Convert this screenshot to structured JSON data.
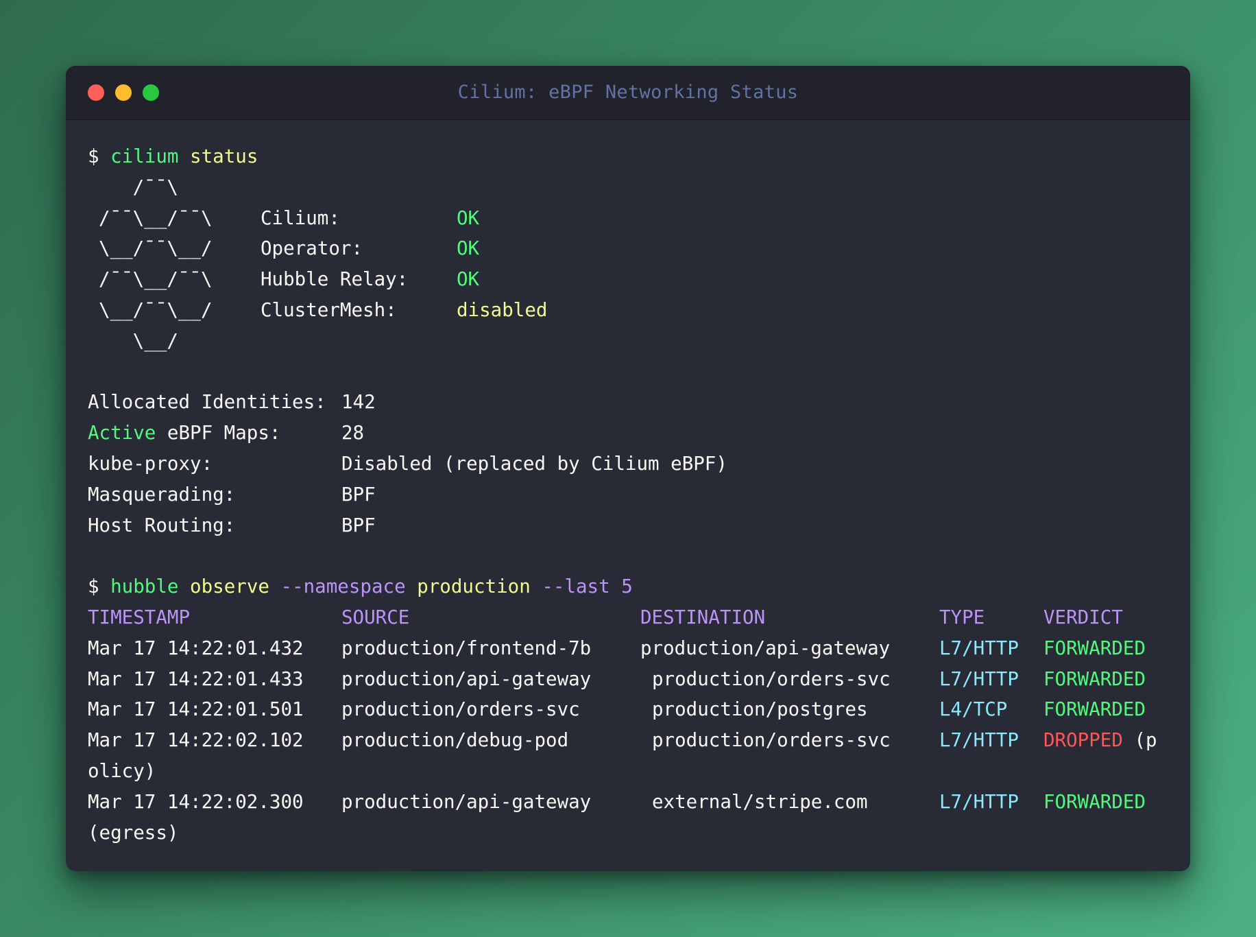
{
  "window": {
    "title": "Cilium: eBPF Networking Status"
  },
  "cmd1": {
    "prompt": "$",
    "program": "cilium",
    "args": "status"
  },
  "logo": [
    "   /¯¯\\",
    "/¯¯\\__/¯¯\\",
    "\\__/¯¯\\__/",
    "/¯¯\\__/¯¯\\",
    "\\__/¯¯\\__/",
    "   \\__/"
  ],
  "status": [
    {
      "label": "Cilium:",
      "value": "OK"
    },
    {
      "label": "Operator:",
      "value": "OK"
    },
    {
      "label": "Hubble Relay:",
      "value": "OK"
    },
    {
      "label": "ClusterMesh:",
      "value": "disabled"
    }
  ],
  "info": [
    {
      "label": "Allocated Identities:",
      "value": "142"
    },
    {
      "label_hl": "Active",
      "label": " eBPF Maps:",
      "value": "28"
    },
    {
      "label": "kube-proxy:",
      "value": "Disabled (replaced by Cilium eBPF)"
    },
    {
      "label": "Masquerading:",
      "value": "BPF"
    },
    {
      "label": "Host Routing:",
      "value": "BPF"
    }
  ],
  "cmd2": {
    "prompt": "$",
    "program": "hubble",
    "subcommand": "observe",
    "flag1": "--namespace",
    "flag1_value": "production",
    "flag2": "--last",
    "flag2_value": "5"
  },
  "table": {
    "headers": [
      "TIMESTAMP",
      "SOURCE",
      "DESTINATION",
      "TYPE",
      "VERDICT"
    ],
    "rows": [
      {
        "timestamp": "Mar 17 14:22:01.432",
        "source": "production/frontend-7b",
        "destination": "production/api-gateway",
        "type": "L7/HTTP",
        "verdict": "FORWARDED",
        "extra": "",
        "wrap": ""
      },
      {
        "timestamp": "Mar 17 14:22:01.433",
        "source": "production/api-gateway",
        "destination": "production/orders-svc",
        "type": "L7/HTTP",
        "verdict": "FORWARDED",
        "extra": "",
        "wrap": ""
      },
      {
        "timestamp": "Mar 17 14:22:01.501",
        "source": "production/orders-svc",
        "destination": "production/postgres",
        "type": "L4/TCP",
        "verdict": "FORWARDED",
        "extra": "",
        "wrap": ""
      },
      {
        "timestamp": "Mar 17 14:22:02.102",
        "source": "production/debug-pod",
        "destination": "production/orders-svc",
        "type": "L7/HTTP",
        "verdict": "DROPPED",
        "extra": "(p",
        "wrap": "olicy)"
      },
      {
        "timestamp": "Mar 17 14:22:02.300",
        "source": "production/api-gateway",
        "destination": "external/stripe.com",
        "type": "L7/HTTP",
        "verdict": "FORWARDED",
        "extra": "",
        "wrap": "(egress)"
      }
    ]
  },
  "colors": {
    "background": "#282a36",
    "titlebar": "#21222c",
    "green": "#50fa7b",
    "yellow": "#f1fa8c",
    "purple": "#bd93f9",
    "cyan": "#8be9fd",
    "red": "#ff5555",
    "foreground": "#f8f8f2"
  }
}
